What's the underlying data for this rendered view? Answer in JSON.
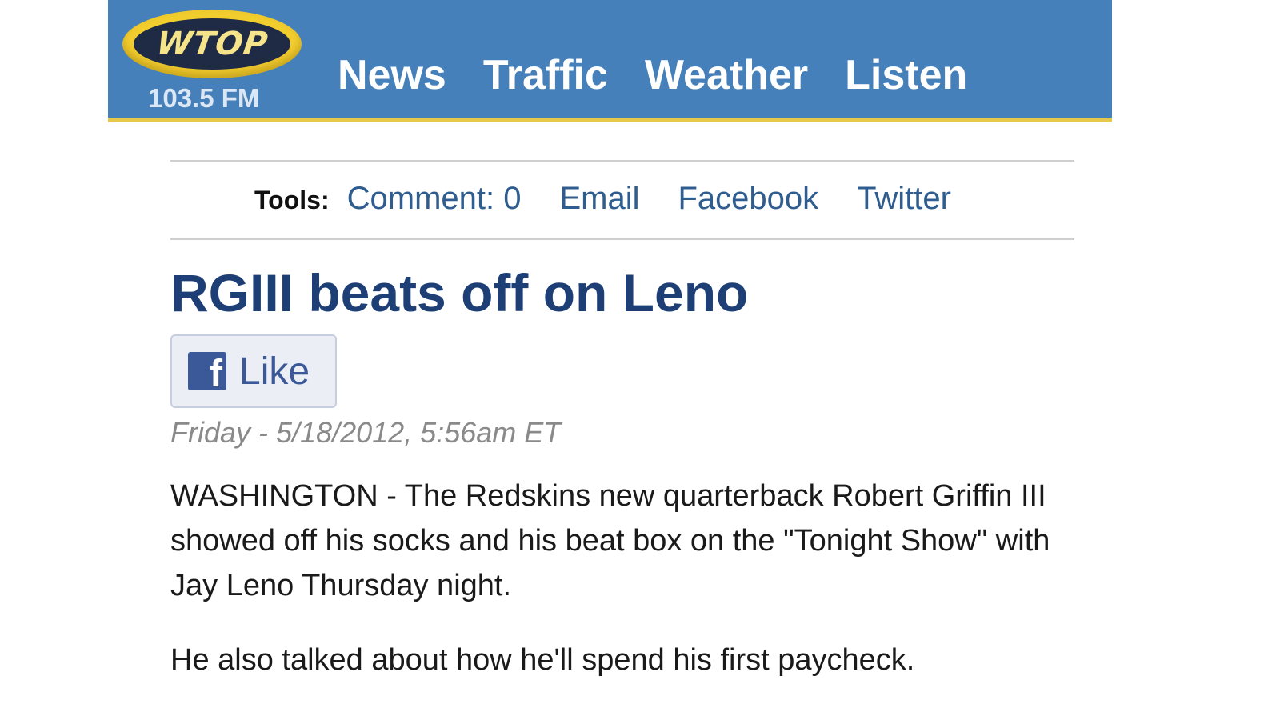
{
  "header": {
    "logo_text": "WTOP",
    "frequency": "103.5 FM",
    "nav": [
      "News",
      "Traffic",
      "Weather",
      "Listen"
    ],
    "colors": {
      "bar": "#4680ba",
      "accent_stripe": "#e6c84a",
      "logo_gold": "#f2cd2e"
    }
  },
  "tools": {
    "label": "Tools:",
    "comment": "Comment: 0",
    "email": "Email",
    "facebook": "Facebook",
    "twitter": "Twitter"
  },
  "article": {
    "headline": "RGIII beats off on Leno",
    "like_icon": "facebook-icon",
    "like_label": "Like",
    "dateline": "Friday - 5/18/2012, 5:56am  ET",
    "paragraphs": [
      "WASHINGTON - The Redskins new quarterback Robert Griffin III showed off his socks and his beat box on the \"Tonight Show\" with Jay Leno Thursday night.",
      "He also talked about how he'll spend his first paycheck."
    ]
  }
}
